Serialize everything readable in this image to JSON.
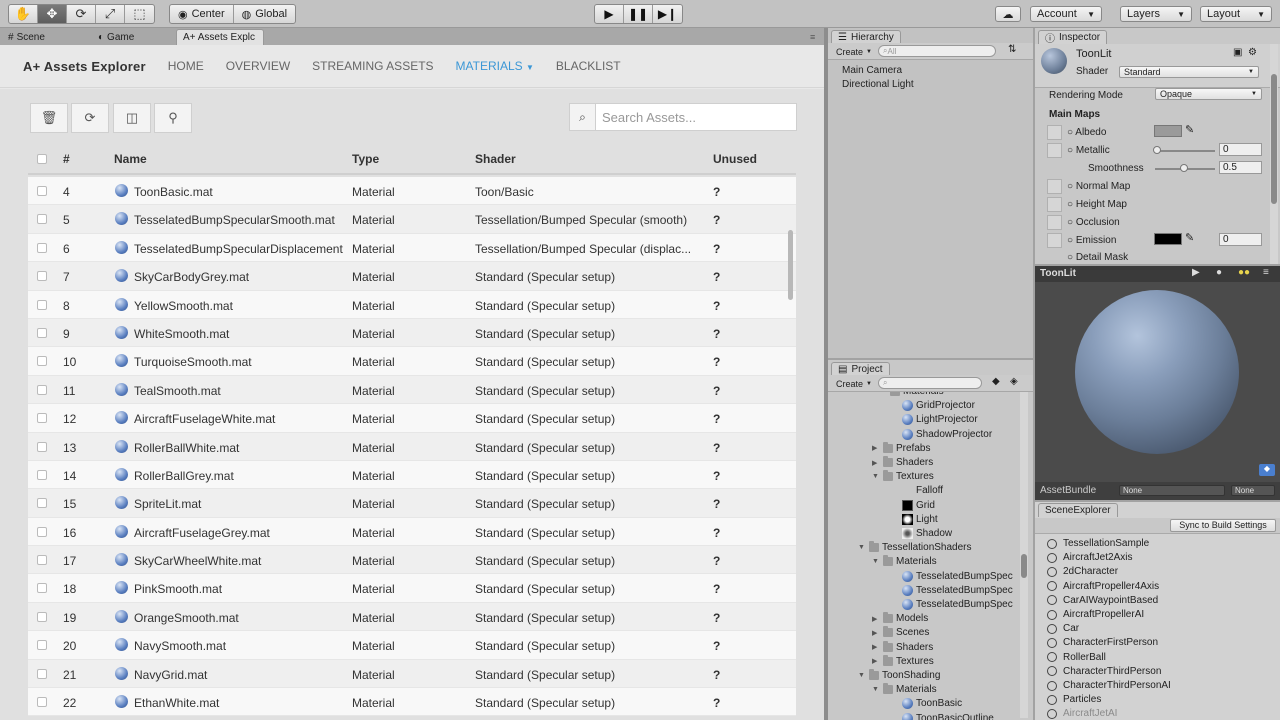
{
  "toolbar": {
    "center_label": "Center",
    "global_label": "Global",
    "account_label": "Account",
    "layers_label": "Layers",
    "layout_label": "Layout"
  },
  "main_tabs": {
    "scene": "Scene",
    "game": "Game",
    "assets_explorer": "A+ Assets Explc"
  },
  "assets_explorer": {
    "brand": "A+ Assets Explorer",
    "nav": [
      "HOME",
      "OVERVIEW",
      "STREAMING ASSETS",
      "MATERIALS",
      "BLACKLIST"
    ],
    "active_nav": "MATERIALS",
    "search_placeholder": "Search Assets...",
    "columns": {
      "num": "#",
      "name": "Name",
      "type": "Type",
      "shader": "Shader",
      "unused": "Unused"
    },
    "rows": [
      {
        "num": "4",
        "name": "ToonBasic.mat",
        "type": "Material",
        "shader": "Toon/Basic",
        "unused": "?"
      },
      {
        "num": "5",
        "name": "TesselatedBumpSpecularSmooth.mat",
        "type": "Material",
        "shader": "Tessellation/Bumped Specular (smooth)",
        "unused": "?"
      },
      {
        "num": "6",
        "name": "TesselatedBumpSpecularDisplacement",
        "type": "Material",
        "shader": "Tessellation/Bumped Specular (displac...",
        "unused": "?"
      },
      {
        "num": "7",
        "name": "SkyCarBodyGrey.mat",
        "type": "Material",
        "shader": "Standard (Specular setup)",
        "unused": "?"
      },
      {
        "num": "8",
        "name": "YellowSmooth.mat",
        "type": "Material",
        "shader": "Standard (Specular setup)",
        "unused": "?"
      },
      {
        "num": "9",
        "name": "WhiteSmooth.mat",
        "type": "Material",
        "shader": "Standard (Specular setup)",
        "unused": "?"
      },
      {
        "num": "10",
        "name": "TurquoiseSmooth.mat",
        "type": "Material",
        "shader": "Standard (Specular setup)",
        "unused": "?"
      },
      {
        "num": "11",
        "name": "TealSmooth.mat",
        "type": "Material",
        "shader": "Standard (Specular setup)",
        "unused": "?"
      },
      {
        "num": "12",
        "name": "AircraftFuselageWhite.mat",
        "type": "Material",
        "shader": "Standard (Specular setup)",
        "unused": "?"
      },
      {
        "num": "13",
        "name": "RollerBallWhite.mat",
        "type": "Material",
        "shader": "Standard (Specular setup)",
        "unused": "?"
      },
      {
        "num": "14",
        "name": "RollerBallGrey.mat",
        "type": "Material",
        "shader": "Standard (Specular setup)",
        "unused": "?"
      },
      {
        "num": "15",
        "name": "SpriteLit.mat",
        "type": "Material",
        "shader": "Standard (Specular setup)",
        "unused": "?"
      },
      {
        "num": "16",
        "name": "AircraftFuselageGrey.mat",
        "type": "Material",
        "shader": "Standard (Specular setup)",
        "unused": "?"
      },
      {
        "num": "17",
        "name": "SkyCarWheelWhite.mat",
        "type": "Material",
        "shader": "Standard (Specular setup)",
        "unused": "?"
      },
      {
        "num": "18",
        "name": "PinkSmooth.mat",
        "type": "Material",
        "shader": "Standard (Specular setup)",
        "unused": "?"
      },
      {
        "num": "19",
        "name": "OrangeSmooth.mat",
        "type": "Material",
        "shader": "Standard (Specular setup)",
        "unused": "?"
      },
      {
        "num": "20",
        "name": "NavySmooth.mat",
        "type": "Material",
        "shader": "Standard (Specular setup)",
        "unused": "?"
      },
      {
        "num": "21",
        "name": "NavyGrid.mat",
        "type": "Material",
        "shader": "Standard (Specular setup)",
        "unused": "?"
      },
      {
        "num": "22",
        "name": "EthanWhite.mat",
        "type": "Material",
        "shader": "Standard (Specular setup)",
        "unused": "?"
      }
    ],
    "accent_color": "#3b97d6"
  },
  "hierarchy": {
    "tab": "Hierarchy",
    "create_label": "Create",
    "search_placeholder": "All",
    "items": [
      "Main Camera",
      "Directional Light"
    ]
  },
  "project": {
    "tab": "Project",
    "create_label": "Create",
    "tree": [
      {
        "label": "Materials",
        "kind": "folder"
      },
      {
        "label": "GridProjector",
        "kind": "material"
      },
      {
        "label": "LightProjector",
        "kind": "material"
      },
      {
        "label": "ShadowProjector",
        "kind": "material"
      },
      {
        "label": "Prefabs",
        "kind": "folder"
      },
      {
        "label": "Shaders",
        "kind": "folder"
      },
      {
        "label": "Textures",
        "kind": "folder"
      },
      {
        "label": "Falloff",
        "kind": "texture-blank"
      },
      {
        "label": "Grid",
        "kind": "texture-grid"
      },
      {
        "label": "Light",
        "kind": "texture-light"
      },
      {
        "label": "Shadow",
        "kind": "texture-shadow"
      },
      {
        "label": "TessellationShaders",
        "kind": "folder"
      },
      {
        "label": "Materials",
        "kind": "folder"
      },
      {
        "label": "TesselatedBumpSpec",
        "kind": "material"
      },
      {
        "label": "TesselatedBumpSpec",
        "kind": "material"
      },
      {
        "label": "TesselatedBumpSpec",
        "kind": "material"
      },
      {
        "label": "Models",
        "kind": "folder"
      },
      {
        "label": "Scenes",
        "kind": "folder"
      },
      {
        "label": "Shaders",
        "kind": "folder"
      },
      {
        "label": "Textures",
        "kind": "folder"
      },
      {
        "label": "ToonShading",
        "kind": "folder"
      },
      {
        "label": "Materials",
        "kind": "folder"
      },
      {
        "label": "ToonBasic",
        "kind": "material"
      },
      {
        "label": "ToonBasicOutline",
        "kind": "material"
      }
    ]
  },
  "inspector": {
    "tab": "Inspector",
    "material_name": "ToonLit",
    "shader_label": "Shader",
    "shader_value": "Standard",
    "rendering_mode_label": "Rendering Mode",
    "rendering_mode_value": "Opaque",
    "main_maps_label": "Main Maps",
    "albedo_label": "Albedo",
    "metallic_label": "Metallic",
    "metallic_value": "0",
    "smoothness_label": "Smoothness",
    "smoothness_value": "0.5",
    "normal_map_label": "Normal Map",
    "height_map_label": "Height Map",
    "occlusion_label": "Occlusion",
    "emission_label": "Emission",
    "emission_value": "0",
    "detail_mask_label": "Detail Mask"
  },
  "preview": {
    "title": "ToonLit",
    "assetbundle_label": "AssetBundle",
    "assetbundle_value": "None",
    "variant_value": "None"
  },
  "scene_explorer": {
    "tab": "SceneExplorer",
    "sync_label": "Sync to Build Settings",
    "scenes": [
      "TessellationSample",
      "AircraftJet2Axis",
      "2dCharacter",
      "AircraftPropeller4Axis",
      "CarAIWaypointBased",
      "AircraftPropellerAI",
      "Car",
      "CharacterFirstPerson",
      "RollerBall",
      "CharacterThirdPerson",
      "CharacterThirdPersonAI",
      "Particles",
      "AircraftJetAI"
    ]
  }
}
